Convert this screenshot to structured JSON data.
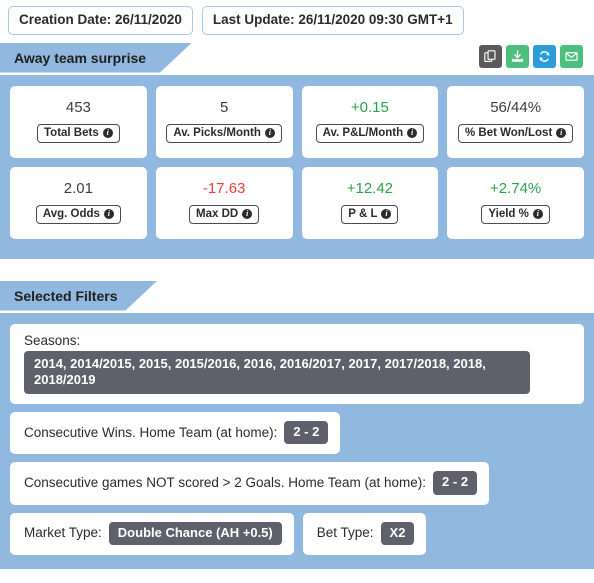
{
  "header": {
    "creation_date_label": "Creation Date: 26/11/2020",
    "last_update_label": "Last Update: 26/11/2020 09:30 GMT+1"
  },
  "strategy_section": {
    "title": "Away team surprise",
    "actions": [
      {
        "name": "copy-icon",
        "title": "Copy",
        "color": "#5a5a5a"
      },
      {
        "name": "download-icon",
        "title": "Download",
        "color": "#4ec07e"
      },
      {
        "name": "refresh-icon",
        "title": "Refresh",
        "color": "#2d9cdb"
      },
      {
        "name": "email-icon",
        "title": "Email",
        "color": "#4ec07e"
      }
    ],
    "stats_row_1": [
      {
        "value": "453",
        "label": "Total Bets",
        "tone": "neutral"
      },
      {
        "value": "5",
        "label": "Av. Picks/Month",
        "tone": "neutral"
      },
      {
        "value": "+0.15",
        "label": "Av. P&L/Month",
        "tone": "pos"
      },
      {
        "value": "56/44%",
        "label": "% Bet Won/Lost",
        "tone": "neutral"
      }
    ],
    "stats_row_2": [
      {
        "value": "2.01",
        "label": "Avg. Odds",
        "tone": "neutral"
      },
      {
        "value": "-17.63",
        "label": "Max DD",
        "tone": "neg"
      },
      {
        "value": "+12.42",
        "label": "P & L",
        "tone": "pos"
      },
      {
        "value": "+2.74%",
        "label": "Yield %",
        "tone": "pos"
      }
    ]
  },
  "filters_section": {
    "title": "Selected Filters",
    "seasons_label": "Seasons:",
    "seasons_value": "2014, 2014/2015, 2015, 2015/2016, 2016, 2016/2017, 2017, 2017/2018, 2018, 2018/2019",
    "consecutive_wins_label": "Consecutive Wins. Home Team (at home):",
    "consecutive_wins_value": "2 - 2",
    "consecutive_not_scored_label": "Consecutive games NOT scored > 2 Goals. Home Team (at home):",
    "consecutive_not_scored_value": "2 - 2",
    "market_type_label": "Market Type:",
    "market_type_value": "Double Chance (AH +0.5)",
    "bet_type_label": "Bet Type:",
    "bet_type_value": "X2"
  },
  "colors": {
    "panel_blue": "#91b9df",
    "chip_grey": "#5e616c",
    "positive_green": "#27a34a",
    "negative_red": "#e8413c"
  }
}
